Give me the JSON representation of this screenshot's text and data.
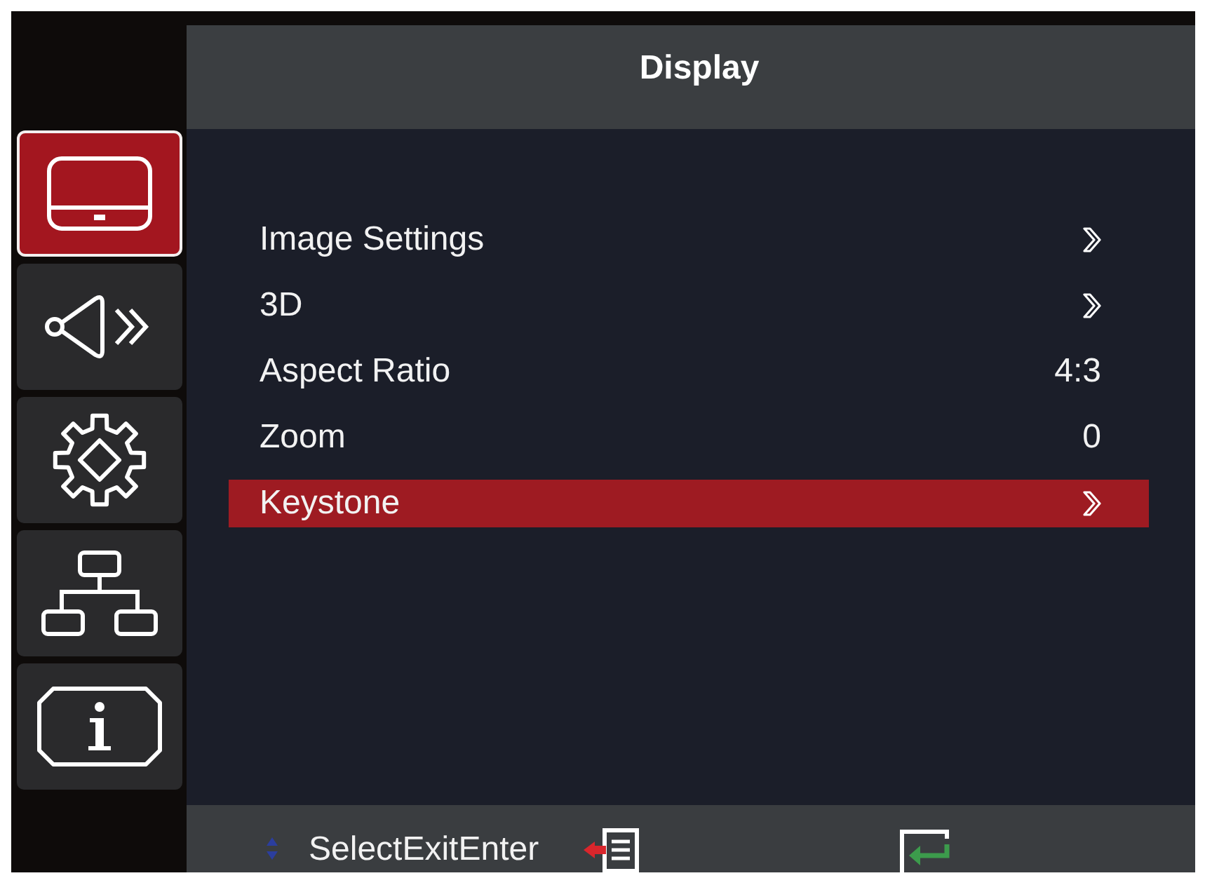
{
  "title": "Display",
  "sidebar": {
    "tabs": [
      {
        "kind": "display",
        "selected": true
      },
      {
        "kind": "audio",
        "selected": false
      },
      {
        "kind": "setup",
        "selected": false
      },
      {
        "kind": "network",
        "selected": false
      },
      {
        "kind": "info",
        "selected": false
      }
    ]
  },
  "menu": {
    "items": [
      {
        "label": "Image Settings",
        "kind": "submenu",
        "selected": false
      },
      {
        "label": "3D",
        "kind": "submenu",
        "selected": false
      },
      {
        "label": "Aspect Ratio",
        "kind": "value",
        "value": "4:3",
        "selected": false
      },
      {
        "label": "Zoom",
        "kind": "value",
        "value": "0",
        "selected": false
      },
      {
        "label": "Keystone",
        "kind": "submenu",
        "selected": true
      }
    ]
  },
  "footer": {
    "hint": "SelectExitEnter"
  }
}
